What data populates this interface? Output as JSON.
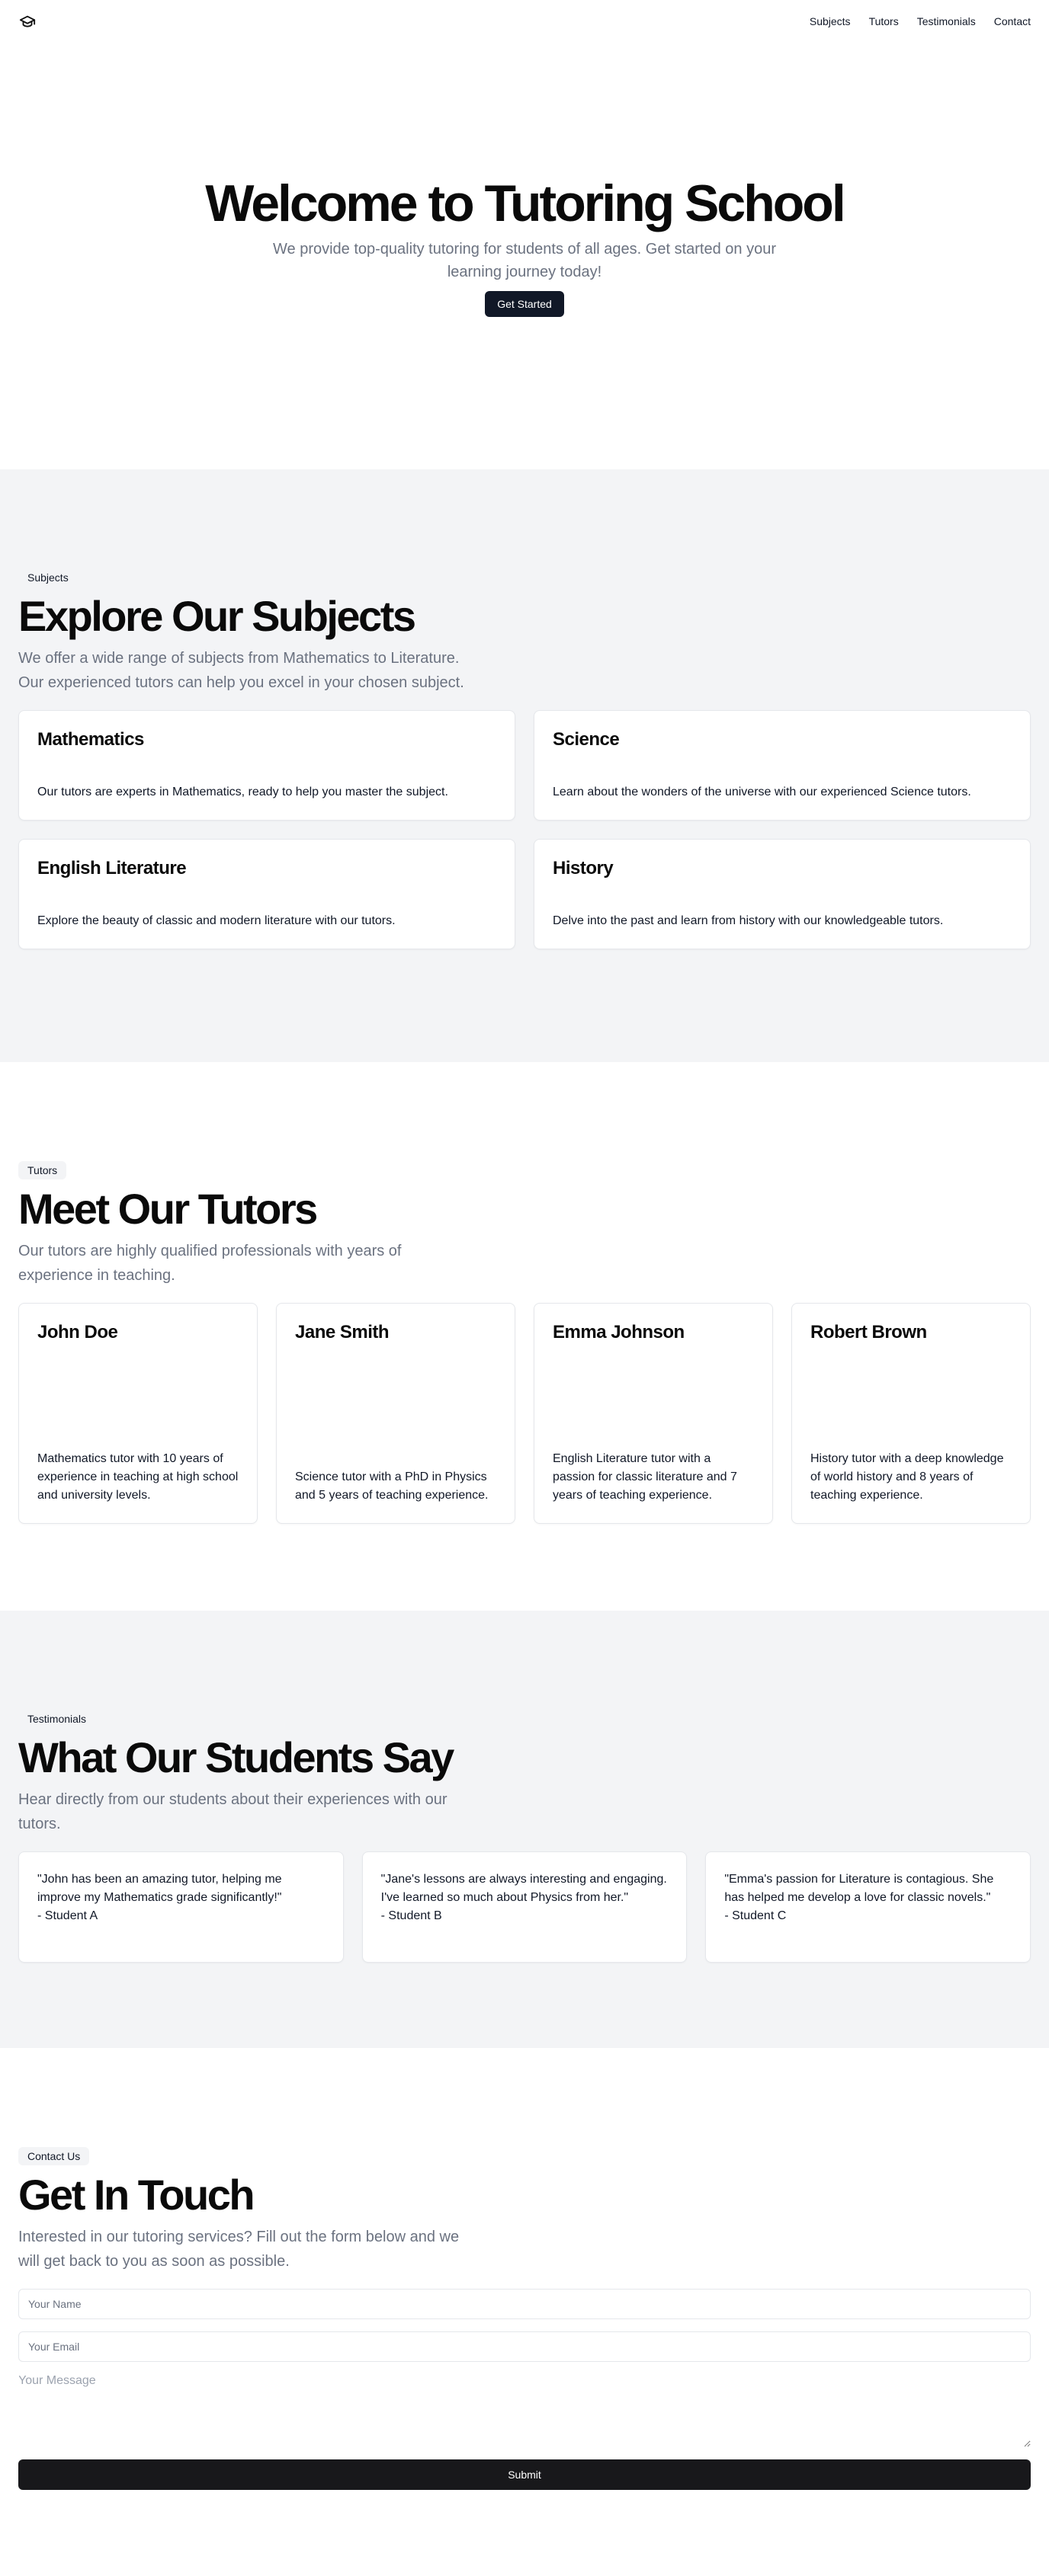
{
  "header": {
    "logo_icon": "graduation-cap-icon",
    "nav": [
      {
        "label": "Subjects"
      },
      {
        "label": "Tutors"
      },
      {
        "label": "Testimonials"
      },
      {
        "label": "Contact"
      }
    ]
  },
  "hero": {
    "title": "Welcome to Tutoring School",
    "subtitle": "We provide top-quality tutoring for students of all ages. Get started on your learning journey today!",
    "cta": "Get Started"
  },
  "subjects": {
    "badge": "Subjects",
    "title": "Explore Our Subjects",
    "subtitle": "We offer a wide range of subjects from Mathematics to Literature. Our experienced tutors can help you excel in your chosen subject.",
    "items": [
      {
        "title": "Mathematics",
        "desc": "Our tutors are experts in Mathematics, ready to help you master the subject."
      },
      {
        "title": "Science",
        "desc": "Learn about the wonders of the universe with our experienced Science tutors."
      },
      {
        "title": "English Literature",
        "desc": "Explore the beauty of classic and modern literature with our tutors."
      },
      {
        "title": "History",
        "desc": "Delve into the past and learn from history with our knowledgeable tutors."
      }
    ]
  },
  "tutors": {
    "badge": "Tutors",
    "title": "Meet Our Tutors",
    "subtitle": "Our tutors are highly qualified professionals with years of experience in teaching.",
    "items": [
      {
        "name": "John Doe",
        "desc": "Mathematics tutor with 10 years of experience in teaching at high school and university levels."
      },
      {
        "name": "Jane Smith",
        "desc": "Science tutor with a PhD in Physics and 5 years of teaching experience."
      },
      {
        "name": "Emma Johnson",
        "desc": "English Literature tutor with a passion for classic literature and 7 years of teaching experience."
      },
      {
        "name": "Robert Brown",
        "desc": "History tutor with a deep knowledge of world history and 8 years of teaching experience."
      }
    ]
  },
  "testimonials": {
    "badge": "Testimonials",
    "title": "What Our Students Say",
    "subtitle": "Hear directly from our students about their experiences with our tutors.",
    "items": [
      {
        "quote": "\"John has been an amazing tutor, helping me improve my Mathematics grade significantly!\"\n- Student A"
      },
      {
        "quote": "\"Jane's lessons are always interesting and engaging. I've learned so much about Physics from her.\"\n- Student B"
      },
      {
        "quote": "\"Emma's passion for Literature is contagious. She has helped me develop a love for classic novels.\"\n- Student C"
      }
    ]
  },
  "contact": {
    "badge": "Contact Us",
    "title": "Get In Touch",
    "subtitle": "Interested in our tutoring services? Fill out the form below and we will get back to you as soon as possible.",
    "name_placeholder": "Your Name",
    "email_placeholder": "Your Email",
    "message_placeholder": "Your Message",
    "submit": "Submit"
  }
}
